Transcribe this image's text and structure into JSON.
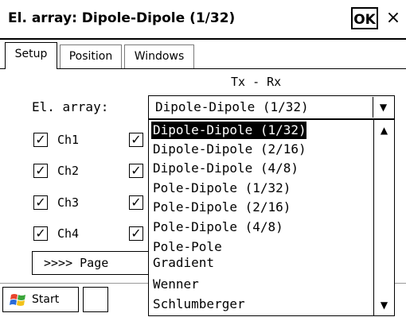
{
  "window": {
    "title": "El. array: Dipole-Dipole (1/32)",
    "ok_label": "OK",
    "close_symbol": "×"
  },
  "tabs": [
    {
      "label": "Setup",
      "active": true
    },
    {
      "label": "Position",
      "active": false
    },
    {
      "label": "Windows",
      "active": false
    }
  ],
  "setup": {
    "txrx_label": "Tx - Rx",
    "el_array_label": "El. array:",
    "el_array_value": "Dipole-Dipole (1/32)",
    "channels": [
      {
        "label": "Ch1",
        "checked": true
      },
      {
        "label": "Ch2",
        "checked": true
      },
      {
        "label": "Ch3",
        "checked": true
      },
      {
        "label": "Ch4",
        "checked": true
      }
    ],
    "page_button_label": ">>>> Page"
  },
  "dropdown": {
    "options": [
      "Dipole-Dipole (1/32)",
      "Dipole-Dipole (2/16)",
      "Dipole-Dipole (4/8)",
      "Pole-Dipole (1/32)",
      "Pole-Dipole (2/16)",
      "Pole-Dipole (4/8)",
      "Pole-Pole",
      "Gradient",
      "Wenner",
      "Schlumberger"
    ],
    "selected_index": 0
  },
  "taskbar": {
    "start_label": "Start"
  },
  "icons": {
    "checkmark": "check-icon",
    "dropdown_arrow": "chevron-down-icon",
    "scroll_up": "chevron-up-icon",
    "start_logo": "windows-flag-icon"
  }
}
